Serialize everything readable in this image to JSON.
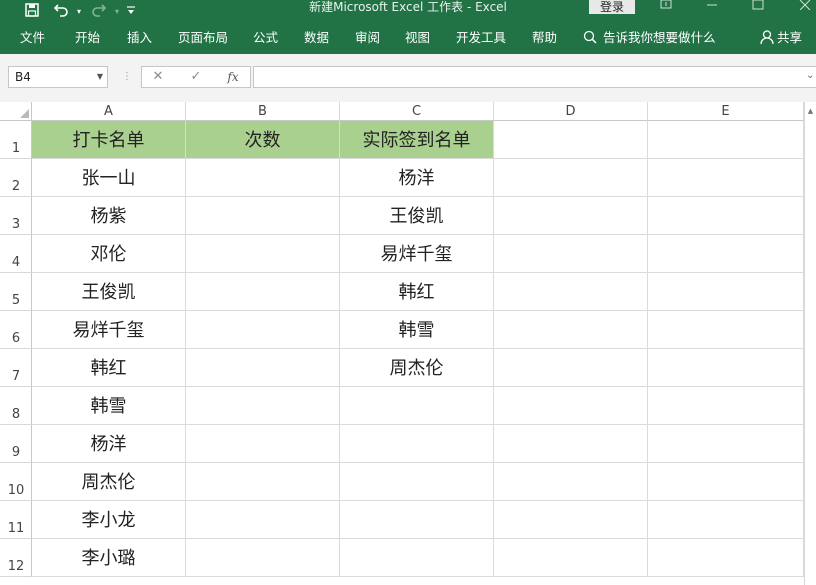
{
  "title_bar": {
    "title": "新建Microsoft Excel 工作表  -  Excel",
    "login_label": "登录",
    "save_icon": "save-icon",
    "undo_icon": "undo-icon",
    "redo_icon": "redo-icon",
    "qat_dropdown_icon": "customize-qat-icon"
  },
  "ribbon": {
    "tabs": [
      "文件",
      "开始",
      "插入",
      "页面布局",
      "公式",
      "数据",
      "审阅",
      "视图",
      "开发工具",
      "帮助"
    ],
    "tell_me": "告诉我你想要做什么",
    "share": "共享"
  },
  "formula_bar": {
    "name_box": "B4",
    "cancel_glyph": "✕",
    "enter_glyph": "✓",
    "fx_glyph": "fx",
    "formula": ""
  },
  "sheet": {
    "columns": [
      "A",
      "B",
      "C",
      "D",
      "E"
    ],
    "rows": [
      "1",
      "2",
      "3",
      "4",
      "5",
      "6",
      "7",
      "8",
      "9",
      "10",
      "11",
      "12"
    ],
    "header_fill": "#A9D08E",
    "cells": [
      [
        "打卡名单",
        "次数",
        "实际签到名单",
        "",
        ""
      ],
      [
        "张一山",
        "",
        "杨洋",
        "",
        ""
      ],
      [
        "杨紫",
        "",
        "王俊凯",
        "",
        ""
      ],
      [
        "邓伦",
        "",
        "易烊千玺",
        "",
        ""
      ],
      [
        "王俊凯",
        "",
        "韩红",
        "",
        ""
      ],
      [
        "易烊千玺",
        "",
        "韩雪",
        "",
        ""
      ],
      [
        "韩红",
        "",
        "周杰伦",
        "",
        ""
      ],
      [
        "韩雪",
        "",
        "",
        "",
        ""
      ],
      [
        "杨洋",
        "",
        "",
        "",
        ""
      ],
      [
        "周杰伦",
        "",
        "",
        "",
        ""
      ],
      [
        "李小龙",
        "",
        "",
        "",
        ""
      ],
      [
        "李小璐",
        "",
        "",
        "",
        ""
      ]
    ]
  },
  "colors": {
    "excel_green": "#217346",
    "grid_line": "#DADADA"
  }
}
